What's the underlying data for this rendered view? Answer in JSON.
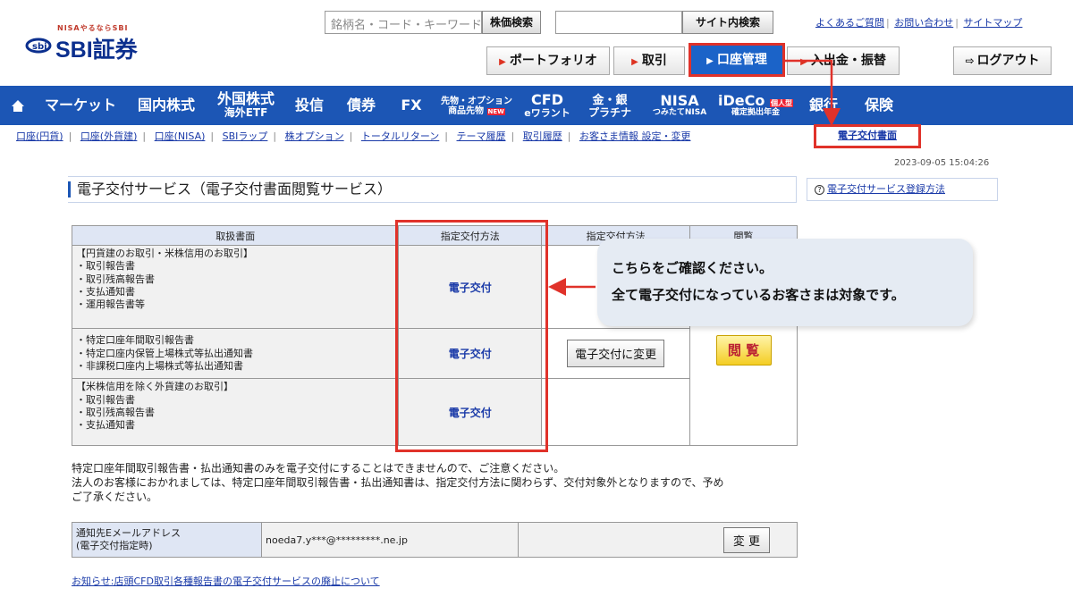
{
  "header": {
    "logo_small": "NISAやるならSBI",
    "logo_text": "SBI証券",
    "stock_search_placeholder": "銘柄名・コード・キーワード",
    "stock_search_button": "株価検索",
    "site_search_value": "",
    "site_search_button": "サイト内検索",
    "top_links": [
      "よくあるご質問",
      "お問い合わせ",
      "サイトマップ"
    ],
    "main_buttons": [
      "ポートフォリオ",
      "取引",
      "口座管理",
      "入出金・振替"
    ],
    "logout": "ログアウト"
  },
  "nav": {
    "items": [
      {
        "label": "マーケット"
      },
      {
        "label": "国内株式"
      },
      {
        "label": "外国株式",
        "sub": "海外ETF"
      },
      {
        "label": "投信"
      },
      {
        "label": "債券"
      },
      {
        "label": "FX"
      },
      {
        "label": "先物・オプション",
        "sub": "商品先物",
        "badge": "NEW"
      },
      {
        "label": "CFD",
        "sub": "eワラント"
      },
      {
        "label": "金・銀",
        "sub": "プラチナ"
      },
      {
        "label": "NISA",
        "sub": "つみたてNISA"
      },
      {
        "label": "iDeCo",
        "sub": "確定拠出年金",
        "badge": "個人型"
      },
      {
        "label": "銀行"
      },
      {
        "label": "保険"
      }
    ]
  },
  "subnav": {
    "items": [
      "口座(円貨)",
      "口座(外貨建)",
      "口座(NISA)",
      "SBIラップ",
      "株オプション",
      "トータルリターン",
      "テーマ履歴",
      "取引履歴",
      "お客さま情報 設定・変更"
    ],
    "active": "電子交付書面"
  },
  "timestamp": "2023-09-05 15:04:26",
  "page": {
    "title": "電子交付サービス（電子交付書面閲覧サービス）",
    "help_link": "電子交付サービス登録方法"
  },
  "table": {
    "headers": [
      "取扱書面",
      "指定交付方法",
      "指定交付方法",
      "閲覧"
    ],
    "rows": [
      {
        "docs": [
          "【円貨建のお取引・米株信用のお取引】",
          "・取引報告書",
          "・取引残高報告書",
          "・支払通知書",
          "・運用報告書等"
        ],
        "method": "電子交付"
      },
      {
        "docs": [
          "・特定口座年間取引報告書",
          "・特定口座内保管上場株式等払出通知書",
          "・非課税口座内上場株式等払出通知書"
        ],
        "method": "電子交付",
        "change_label": "電子交付に変更"
      },
      {
        "docs": [
          "【米株信用を除く外貨建のお取引】",
          "・取引報告書",
          "・取引残高報告書",
          "・支払通知書"
        ],
        "method": "電子交付"
      }
    ],
    "view_label": "閲 覧"
  },
  "callout": {
    "line1": "こちらをご確認ください。",
    "line2": "全て電子交付になっているお客さまは対象です。"
  },
  "notes": {
    "line1": "特定口座年間取引報告書・払出通知書のみを電子交付にすることはできませんので、ご注意ください。",
    "line2": "法人のお客様におかれましては、特定口座年間取引報告書・払出通知書は、指定交付方法に関わらず、交付対象外となりますので、予め",
    "line3": "ご了承ください。"
  },
  "mail": {
    "label_line1": "通知先Eメールアドレス",
    "label_line2": "(電子交付指定時)",
    "value": "noeda7.y***@*********.ne.jp",
    "button": "変 更"
  },
  "notice": "お知らせ:店頭CFD取引各種報告書の電子交付サービスの廃止について",
  "colors": {
    "nav_blue": "#1c56b5",
    "highlight_red": "#e0322a",
    "link_blue": "#1a3aa8"
  }
}
